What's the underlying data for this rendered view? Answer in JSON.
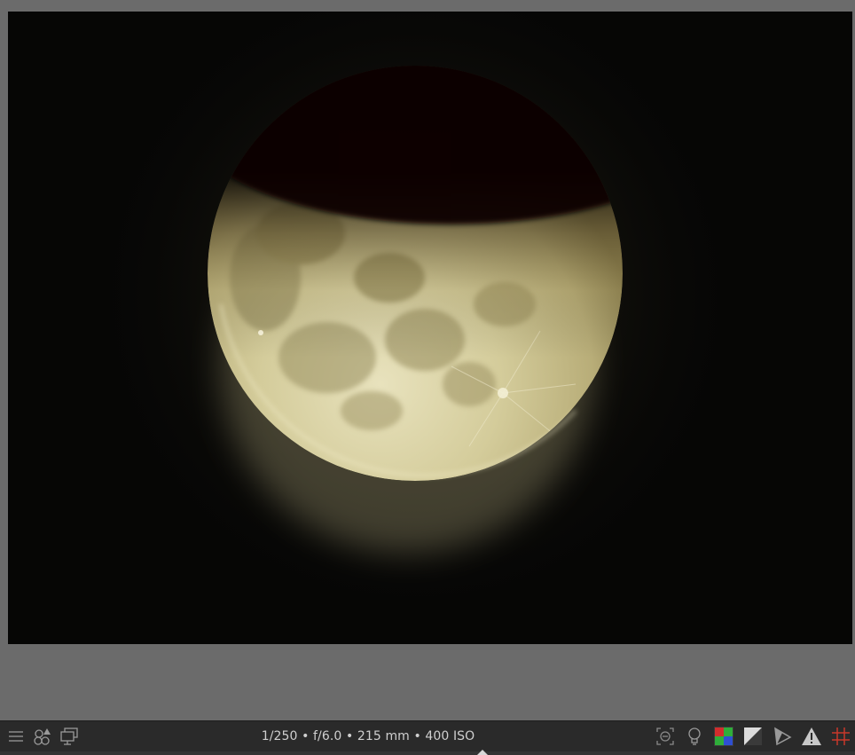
{
  "viewer": {
    "image_subject": "moon",
    "background_color": "#6b6b6b"
  },
  "status_bar": {
    "exif": "1/250 • f/6.0 • 215 mm • 400 ISO",
    "left_icons": [
      "menu-icon",
      "color-labels-icon",
      "display-icon"
    ],
    "right_icons": [
      "focus-peaking-icon",
      "lightbulb-icon",
      "color-assessment-icon",
      "softproof-icon",
      "gamut-check-icon",
      "warning-icon",
      "guides-grid-icon"
    ],
    "accent_colors": {
      "red": "#d22d2d",
      "green": "#2fae3a",
      "blue": "#2f4fd2",
      "grid": "#c8382a"
    }
  }
}
